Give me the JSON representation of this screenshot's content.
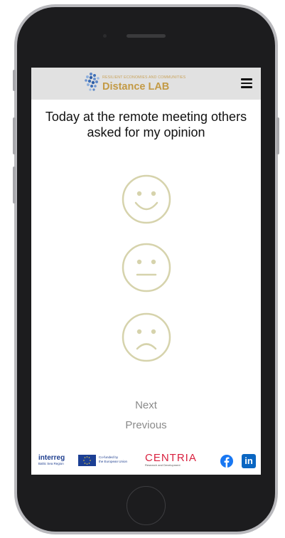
{
  "header": {
    "logo_tagline": "RESILIENT ECONOMIES AND COMMUNITIES",
    "logo_title": "Distance LAB",
    "menu_icon": "hamburger-menu-icon"
  },
  "survey": {
    "question": "Today at the remote meeting others asked for my opinion",
    "options": [
      "smiley-happy-icon",
      "smiley-neutral-icon",
      "smiley-sad-icon"
    ],
    "face_color": "#d6d3ac"
  },
  "nav": {
    "next_label": "Next",
    "previous_label": "Previous"
  },
  "footer": {
    "interreg_name": "interreg",
    "interreg_sub": "Baltic Sea Region",
    "eu_text_line1": "Co-funded by",
    "eu_text_line2": "the European Union",
    "centria_name": "CENTRIA",
    "centria_sub": "Research and Development",
    "social": [
      "facebook-icon",
      "linkedin-icon"
    ],
    "linkedin_glyph": "in"
  }
}
